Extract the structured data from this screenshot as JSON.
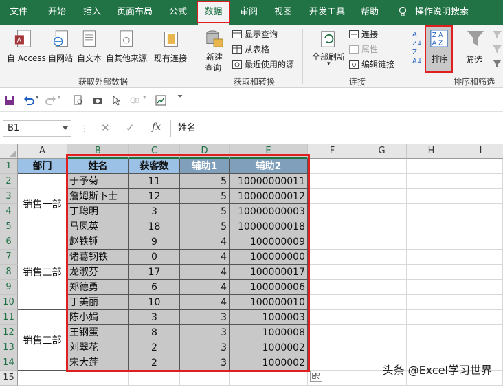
{
  "tabs": [
    "文件",
    "开始",
    "插入",
    "页面布局",
    "公式",
    "数据",
    "审阅",
    "视图",
    "开发工具",
    "帮助"
  ],
  "tell_me": "操作说明搜索",
  "ribbon": {
    "get_external": {
      "access": "自 Access",
      "web": "自网站",
      "text": "自文本",
      "other": "自其他来源",
      "existing": "现有连接",
      "label": "获取外部数据"
    },
    "transform": {
      "new_query": "新建",
      "new_query2": "查询",
      "show_query": "显示查询",
      "from_table": "从表格",
      "recent": "最近使用的源",
      "label": "获取和转换"
    },
    "connections": {
      "refresh_all": "全部刷新",
      "connections": "连接",
      "properties": "属性",
      "edit_links": "编辑链接",
      "label": "连接"
    },
    "sort_filter": {
      "sort": "排序",
      "filter": "筛选",
      "label": "排序和筛选"
    }
  },
  "formula_bar": {
    "name_box": "B1",
    "content": "姓名"
  },
  "columns": [
    "A",
    "B",
    "C",
    "D",
    "E",
    "F",
    "G",
    "H",
    "I"
  ],
  "rows": [
    "1",
    "2",
    "3",
    "4",
    "5",
    "6",
    "7",
    "8",
    "9",
    "10",
    "11",
    "12",
    "13",
    "14",
    "15"
  ],
  "header": {
    "dept": "部门",
    "name": "姓名",
    "customers": "获客数",
    "aux1": "辅助1",
    "aux2": "辅助2"
  },
  "departments": [
    "销售一部",
    "销售二部",
    "销售三部"
  ],
  "table": [
    {
      "name": "于予菊",
      "customers": "11",
      "aux1": "5",
      "aux2": "10000000011"
    },
    {
      "name": "詹姆斯下士",
      "customers": "12",
      "aux1": "5",
      "aux2": "10000000012"
    },
    {
      "name": "丁聪明",
      "customers": "3",
      "aux1": "5",
      "aux2": "10000000003"
    },
    {
      "name": "马凤英",
      "customers": "18",
      "aux1": "5",
      "aux2": "10000000018"
    },
    {
      "name": "赵铁锤",
      "customers": "9",
      "aux1": "4",
      "aux2": "100000009"
    },
    {
      "name": "诸葛钢铁",
      "customers": "0",
      "aux1": "4",
      "aux2": "100000000"
    },
    {
      "name": "龙淑芬",
      "customers": "17",
      "aux1": "4",
      "aux2": "100000017"
    },
    {
      "name": "郑德勇",
      "customers": "6",
      "aux1": "4",
      "aux2": "100000006"
    },
    {
      "name": "丁美丽",
      "customers": "10",
      "aux1": "4",
      "aux2": "100000010"
    },
    {
      "name": "陈小娟",
      "customers": "3",
      "aux1": "3",
      "aux2": "1000003"
    },
    {
      "name": "王钢蛋",
      "customers": "8",
      "aux1": "3",
      "aux2": "1000008"
    },
    {
      "name": "刘翠花",
      "customers": "2",
      "aux1": "3",
      "aux2": "1000002"
    },
    {
      "name": "宋大莲",
      "customers": "2",
      "aux1": "3",
      "aux2": "1000002"
    }
  ],
  "watermark": "头条 @Excel学习世界",
  "colors": {
    "excel_green": "#217346",
    "highlight": "#e02020",
    "header_blue": "#9bc2e6",
    "selection_gray": "#c8c8c8"
  }
}
